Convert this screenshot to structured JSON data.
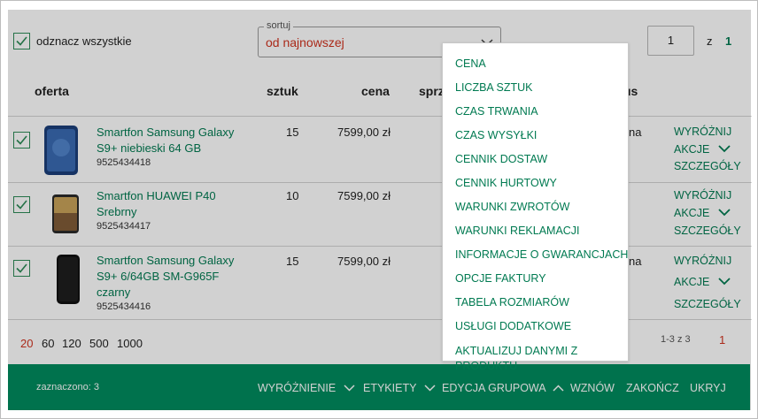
{
  "select_all_label": "odznacz wszystkie",
  "sort": {
    "legend": "sortuj",
    "value": "od najnowszej"
  },
  "pagination_top": {
    "current": "1",
    "of_label": "z",
    "total": "1"
  },
  "headers": {
    "oferta": "oferta",
    "sztuk": "sztuk",
    "cena": "cena",
    "sprzedaz": "sprz",
    "status": "us"
  },
  "offers": [
    {
      "title_line1": "Smartfon Samsung Galaxy",
      "title_line2": "S9+ niebieski 64 GB",
      "title_line3": "",
      "sku": "9525434418",
      "qty": "15",
      "price": "7599,00 zł",
      "status_frag": "na",
      "actions": [
        "WYRÓŻNIJ",
        "AKCJE",
        "SZCZEGÓŁY"
      ]
    },
    {
      "title_line1": "Smartfon HUAWEI P40",
      "title_line2": "Srebrny",
      "title_line3": "",
      "sku": "9525434417",
      "qty": "10",
      "price": "7599,00 zł",
      "status_frag": "na",
      "actions": [
        "WYRÓŻNIJ",
        "AKCJE",
        "SZCZEGÓŁY"
      ]
    },
    {
      "title_line1": "Smartfon Samsung Galaxy",
      "title_line2": "S9+ 6/64GB SM-G965F",
      "title_line3": "czarny",
      "sku": "9525434416",
      "qty": "15",
      "price": "7599,00 zł",
      "status_frag": "na",
      "actions": [
        "WYRÓŻNIJ",
        "AKCJE",
        "SZCZEGÓŁY"
      ]
    }
  ],
  "page_sizes": [
    "20",
    "60",
    "120",
    "500",
    "1000"
  ],
  "page_size_active": "20",
  "range_text": "1-3 z 3",
  "page_number": "1",
  "bottom_bar": {
    "selected": "zaznaczono: 3",
    "wyroznienie": "WYRÓŻNIENIE",
    "etykiety": "ETYKIETY",
    "edycja": "EDYCJA GRUPOWA",
    "wznow": "WZNÓW",
    "zakoncz": "ZAKOŃCZ",
    "ukryj": "UKRYJ"
  },
  "dropdown_items": [
    "CENA",
    "LICZBA SZTUK",
    "CZAS TRWANIA",
    "CZAS WYSYŁKI",
    "CENNIK DOSTAW",
    "CENNIK HURTOWY",
    "WARUNKI ZWROTÓW",
    "WARUNKI REKLAMACJI",
    "INFORMACJE O GWARANCJACH",
    "OPCJE FAKTURY",
    "TABELA ROZMIARÓW",
    "USŁUGI DODATKOWE",
    "AKTUALIZUJ DANYMI Z",
    "PRODUKTU"
  ],
  "colors": {
    "accent_green": "#007a51",
    "bar_green": "#008c5f",
    "red": "#d0331f"
  }
}
